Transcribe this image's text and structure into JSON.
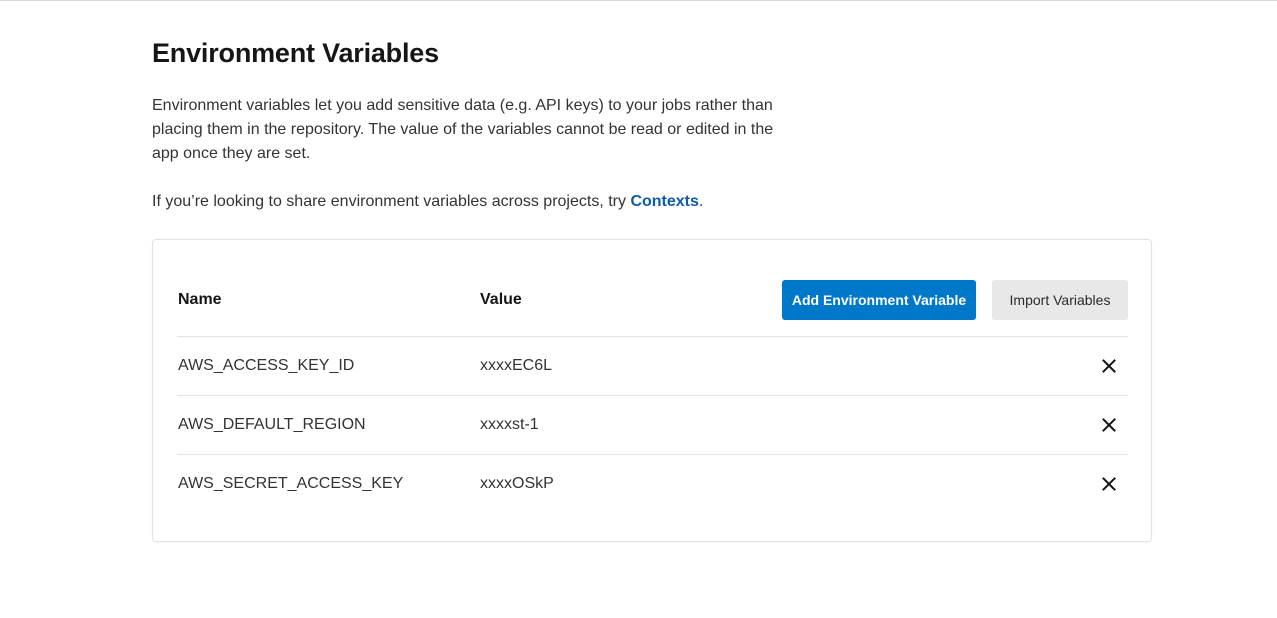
{
  "page": {
    "title": "Environment Variables",
    "description": "Environment variables let you add sensitive data (e.g. API keys) to your jobs rather than placing them in the repository. The value of the variables cannot be read or edited in the app once they are set.",
    "contexts_prefix": "If you’re looking to share environment variables across projects, try ",
    "contexts_link": "Contexts",
    "contexts_suffix": "."
  },
  "table": {
    "headers": {
      "name": "Name",
      "value": "Value"
    },
    "buttons": {
      "add": "Add Environment Variable",
      "import": "Import Variables"
    },
    "rows": [
      {
        "name": "AWS_ACCESS_KEY_ID",
        "value": "xxxxEC6L"
      },
      {
        "name": "AWS_DEFAULT_REGION",
        "value": "xxxxst-1"
      },
      {
        "name": "AWS_SECRET_ACCESS_KEY",
        "value": "xxxxOSkP"
      }
    ]
  },
  "colors": {
    "primary_button": "#0078ca",
    "secondary_button": "#e8e8e8",
    "link": "#0e5ba8"
  },
  "icons": {
    "delete": "close-icon"
  }
}
